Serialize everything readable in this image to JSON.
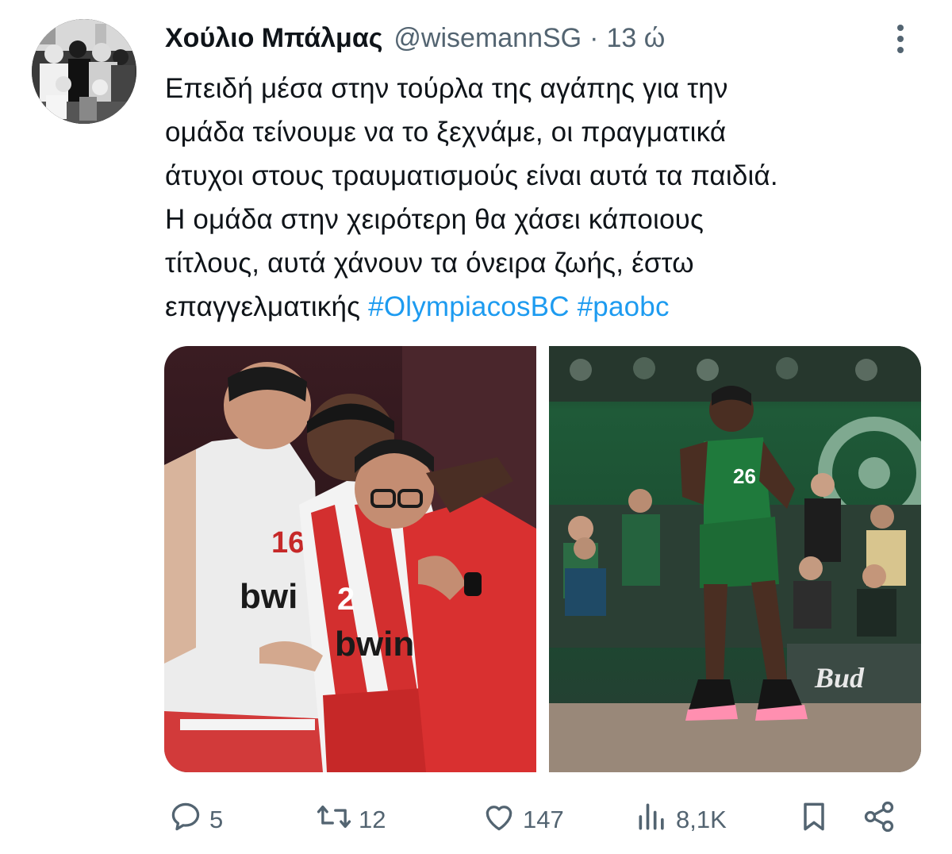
{
  "tweet": {
    "display_name": "Χούλιο Μπάλμας",
    "handle": "@wisemannSG",
    "separator": "·",
    "time": "13 ώ",
    "text_lines": [
      "Επειδή μέσα στην τούρλα της αγάπης για την",
      "ομάδα τείνουμε να το ξεχνάμε, οι πραγματικά",
      "άτυχοι στους τραυματισμούς είναι αυτά τα παιδιά.",
      "Η ομάδα στην χειρότερη θα χάσει κάποιους",
      "τίτλους, αυτά χάνουν τα όνειρα ζωής, έστω",
      "επαγγελματικής"
    ],
    "hashtags": [
      "#OlympiacosBC",
      "#paobc"
    ]
  },
  "media": {
    "left_photo": {
      "jersey_back_number": "16",
      "jersey_front_number": "2",
      "sponsor": "bwin",
      "sponsor_partial": "bwi"
    },
    "right_photo": {
      "jersey_number": "26",
      "board_text": "Bud"
    }
  },
  "actions": {
    "replies": "5",
    "retweets": "12",
    "likes": "147",
    "views": "8,1K"
  },
  "icons": {
    "more": "more-vertical-icon",
    "reply": "reply-icon",
    "retweet": "retweet-icon",
    "like": "heart-icon",
    "views": "views-icon",
    "bookmark": "bookmark-icon",
    "share": "share-icon"
  },
  "colors": {
    "text": "#0f1419",
    "secondary": "#536471",
    "link": "#1d9bf0",
    "olympiacos_red": "#d62828",
    "panathinaikos_green": "#1f6b3a"
  }
}
